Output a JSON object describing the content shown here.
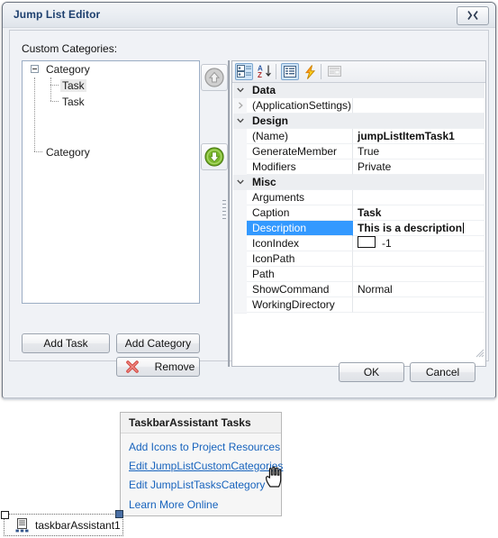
{
  "dialog": {
    "title": "Jump List Editor",
    "close_label": "Close",
    "left": {
      "label": "Custom Categories:",
      "tree": [
        {
          "label": "Category",
          "depth": 0,
          "expanded": true,
          "selected": false
        },
        {
          "label": "Task",
          "depth": 1,
          "expanded": false,
          "selected": true
        },
        {
          "label": "Task",
          "depth": 1,
          "expanded": false,
          "selected": false
        },
        {
          "label": "Category",
          "depth": 0,
          "expanded": false,
          "selected": false
        }
      ],
      "move_up_icon": "arrow-up-circle-icon",
      "move_down_icon": "arrow-down-circle-icon",
      "buttons": {
        "add_task": "Add Task",
        "add_category": "Add Category",
        "remove": "Remove",
        "remove_icon": "red-x-icon"
      }
    },
    "propertygrid": {
      "toolbar": [
        {
          "name": "categorized-view-button",
          "icon": "categorized-icon",
          "active": true
        },
        {
          "name": "alphabetical-sort-button",
          "icon": "sort-az-icon",
          "active": false
        },
        {
          "name": "properties-button",
          "icon": "properties-icon",
          "active": true
        },
        {
          "name": "events-button",
          "icon": "lightning-icon",
          "active": false
        },
        {
          "name": "property-pages-button",
          "icon": "property-pages-icon",
          "active": false,
          "disabled": true
        }
      ],
      "rows": [
        {
          "kind": "category",
          "name": "Data",
          "value": "",
          "expanded": true
        },
        {
          "kind": "property",
          "name": "(ApplicationSettings)",
          "value": "",
          "expandable": true
        },
        {
          "kind": "category",
          "name": "Design",
          "value": "",
          "expanded": true
        },
        {
          "kind": "property",
          "name": "(Name)",
          "value": "jumpListItemTask1",
          "bold": true
        },
        {
          "kind": "property",
          "name": "GenerateMember",
          "value": "True"
        },
        {
          "kind": "property",
          "name": "Modifiers",
          "value": "Private"
        },
        {
          "kind": "category",
          "name": "Misc",
          "value": "",
          "expanded": true
        },
        {
          "kind": "property",
          "name": "Arguments",
          "value": ""
        },
        {
          "kind": "property",
          "name": "Caption",
          "value": "Task",
          "bold": true
        },
        {
          "kind": "property",
          "name": "Description",
          "value": "This is a description",
          "bold": true,
          "selected": true,
          "editing": true
        },
        {
          "kind": "property",
          "name": "IconIndex",
          "value": "-1",
          "swatch": true
        },
        {
          "kind": "property",
          "name": "IconPath",
          "value": ""
        },
        {
          "kind": "property",
          "name": "Path",
          "value": ""
        },
        {
          "kind": "property",
          "name": "ShowCommand",
          "value": "Normal"
        },
        {
          "kind": "property",
          "name": "WorkingDirectory",
          "value": ""
        }
      ]
    },
    "footer": {
      "ok": "OK",
      "cancel": "Cancel"
    }
  },
  "smarttag": {
    "title": "TaskbarAssistant Tasks",
    "items": [
      {
        "label": "Add Icons to Project Resources",
        "hover": false
      },
      {
        "label": "Edit JumpListCustomCategories",
        "hover": true
      },
      {
        "label": "Edit JumpListTasksCategory",
        "hover": false
      },
      {
        "label": "Learn More Online",
        "hover": false
      }
    ]
  },
  "tray": {
    "component_name": "taskbarAssistant1",
    "icon": "component-icon"
  },
  "colors": {
    "accent_selection": "#3399ff",
    "link": "#1763bd",
    "title_text": "#1d3f6e",
    "toolbar_active": "#cfe4f7"
  }
}
